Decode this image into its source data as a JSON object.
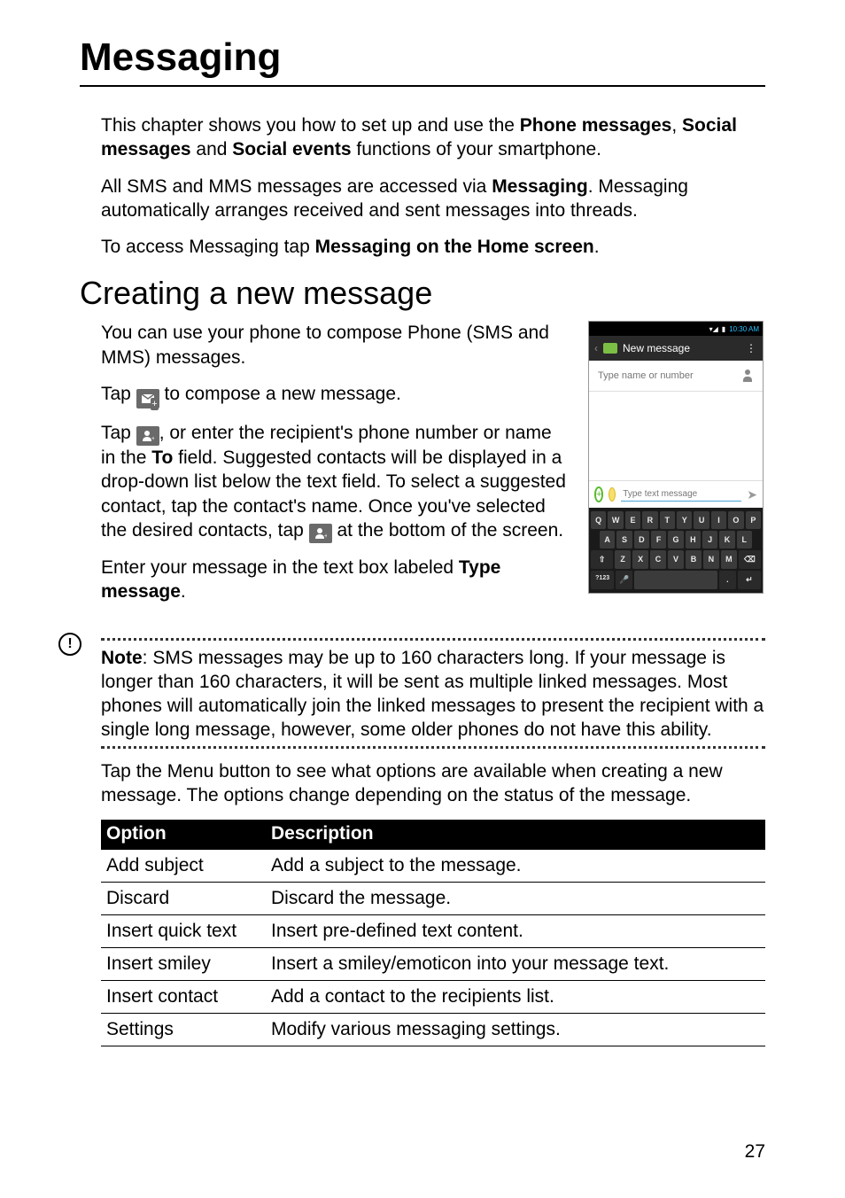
{
  "page": {
    "chapter_title": "Messaging",
    "page_number": "27"
  },
  "intro": {
    "p1_a": "This chapter shows you how to set up and use the ",
    "p1_b": "Phone messages",
    "p1_c": ", ",
    "p1_d": "Social messages",
    "p1_e": " and ",
    "p1_f": "Social events",
    "p1_g": " functions of your smartphone.",
    "p2_a": "All SMS and MMS messages are accessed via ",
    "p2_b": "Messaging",
    "p2_c": ". Messaging automatically arranges received and sent messages into threads.",
    "p3_a": "To access Messaging tap ",
    "p3_b": "Messaging on the Home screen",
    "p3_c": "."
  },
  "section": {
    "heading": "Creating a new message",
    "p1": "You can use your phone to compose Phone (SMS and MMS) messages.",
    "p2_a": "Tap ",
    "p2_b": " to compose a new message.",
    "p3_a": "Tap ",
    "p3_b": ", or enter the recipient's phone number or name in the ",
    "p3_c": "To",
    "p3_d": " field. Suggested contacts will be displayed in a drop-down list below the text field. To select a suggested contact, tap the contact's name. Once you've selected the desired contacts, tap ",
    "p3_e": " at the bottom of the screen.",
    "p4_a": "Enter your message in the text box labeled ",
    "p4_b": "Type message",
    "p4_c": "."
  },
  "note": {
    "label": "Note",
    "text": ": SMS messages may be up to 160 characters long. If your message is longer than 160 characters, it will be sent as multiple linked messages. Most phones will automatically join the linked messages to present the recipient with a single long message, however, some older phones do not have this ability."
  },
  "after_note": "Tap the Menu button to see what options are available when creating a new message. The options change depending on the status of the message.",
  "table": {
    "col1": "Option",
    "col2": "Description",
    "rows": [
      {
        "opt": "Add subject",
        "desc": "Add a subject to the message."
      },
      {
        "opt": "Discard",
        "desc": "Discard the message."
      },
      {
        "opt": "Insert quick text",
        "desc": "Insert pre-defined text content."
      },
      {
        "opt": "Insert smiley",
        "desc": "Insert a smiley/emoticon into your message text."
      },
      {
        "opt": "Insert contact",
        "desc": "Add a contact to the recipients list."
      },
      {
        "opt": "Settings",
        "desc": "Modify various messaging settings."
      }
    ]
  },
  "phone": {
    "time": "10:30 AM",
    "header": "New message",
    "to_placeholder": "Type name or number",
    "msg_placeholder": "Type text message",
    "kb_row1": [
      "Q",
      "W",
      "E",
      "R",
      "T",
      "Y",
      "U",
      "I",
      "O",
      "P"
    ],
    "kb_row2": [
      "A",
      "S",
      "D",
      "F",
      "G",
      "H",
      "J",
      "K",
      "L"
    ],
    "kb_row3_shift": "⇧",
    "kb_row3": [
      "Z",
      "X",
      "C",
      "V",
      "B",
      "N",
      "M"
    ],
    "kb_row3_del": "⌫",
    "kb_row4_sym": "?123",
    "kb_row4_mic": "🎤",
    "kb_row4_period": ".",
    "kb_row4_enter": "↵"
  }
}
